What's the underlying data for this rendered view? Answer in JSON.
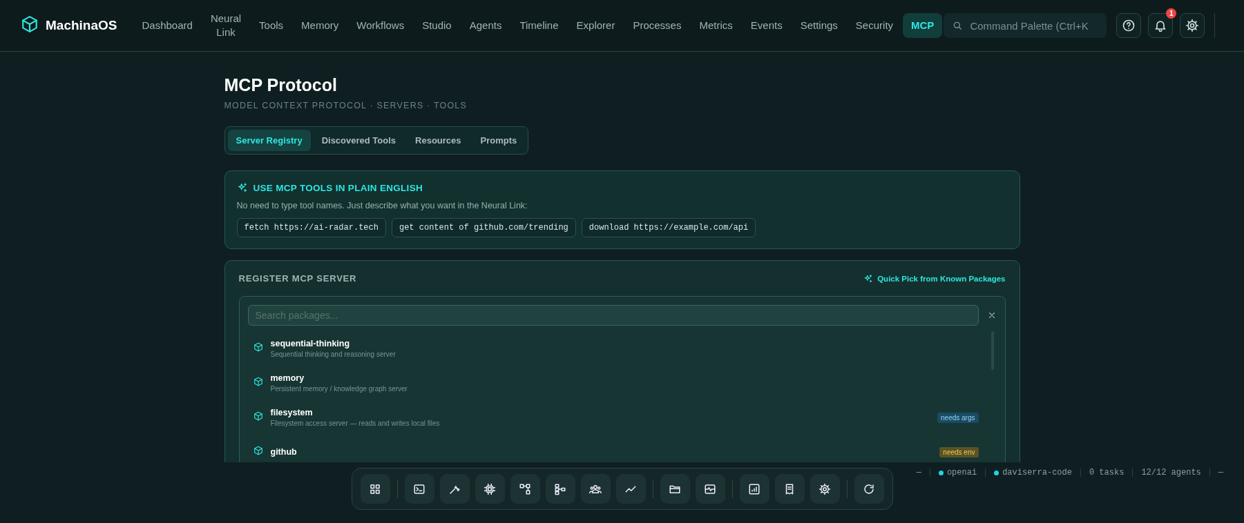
{
  "brand": {
    "name": "MachinaOS"
  },
  "nav": [
    {
      "label": "Dashboard",
      "selected": false
    },
    {
      "label": "Neural Link",
      "selected": false
    },
    {
      "label": "Tools",
      "selected": false
    },
    {
      "label": "Memory",
      "selected": false
    },
    {
      "label": "Workflows",
      "selected": false
    },
    {
      "label": "Studio",
      "selected": false
    },
    {
      "label": "Agents",
      "selected": false
    },
    {
      "label": "Timeline",
      "selected": false
    },
    {
      "label": "Explorer",
      "selected": false
    },
    {
      "label": "Processes",
      "selected": false
    },
    {
      "label": "Metrics",
      "selected": false
    },
    {
      "label": "Events",
      "selected": false
    },
    {
      "label": "Settings",
      "selected": false
    },
    {
      "label": "Security",
      "selected": false
    },
    {
      "label": "MCP",
      "selected": true
    }
  ],
  "command_palette": {
    "placeholder": "Command Palette (Ctrl+K"
  },
  "notifications": {
    "count": "1"
  },
  "page": {
    "title": "MCP Protocol",
    "subtitle": "MODEL CONTEXT PROTOCOL · SERVERS · TOOLS"
  },
  "tabs": [
    {
      "label": "Server Registry",
      "selected": true
    },
    {
      "label": "Discovered Tools",
      "selected": false
    },
    {
      "label": "Resources",
      "selected": false
    },
    {
      "label": "Prompts",
      "selected": false
    }
  ],
  "hint": {
    "title": "USE MCP TOOLS IN PLAIN ENGLISH",
    "text": "No need to type tool names. Just describe what you want in the Neural Link:",
    "examples": [
      "fetch https://ai-radar.tech",
      "get content of github.com/trending",
      "download https://example.com/api"
    ]
  },
  "register": {
    "title": "REGISTER MCP SERVER",
    "quick_pick": "Quick Pick from Known Packages",
    "search": {
      "placeholder": "Search packages..."
    },
    "packages": [
      {
        "name": "sequential-thinking",
        "description": "Sequential thinking and reasoning server"
      },
      {
        "name": "memory",
        "description": "Persistent memory / knowledge graph server"
      },
      {
        "name": "filesystem",
        "description": "Filesystem access server — reads and writes local files",
        "badge": {
          "label": "needs args",
          "kind": "args"
        }
      },
      {
        "name": "github",
        "badge": {
          "label": "needs env",
          "kind": "env"
        }
      }
    ]
  },
  "status_bar": [
    {
      "kind": "text",
      "label": "—"
    },
    {
      "kind": "dot",
      "label": "openai",
      "color": "#22d3e6"
    },
    {
      "kind": "dot",
      "label": "daviserra-code",
      "color": "#22d3e6"
    },
    {
      "kind": "text",
      "label": "0 tasks"
    },
    {
      "kind": "text",
      "label": "12/12 agents"
    },
    {
      "kind": "text",
      "label": "—"
    }
  ]
}
